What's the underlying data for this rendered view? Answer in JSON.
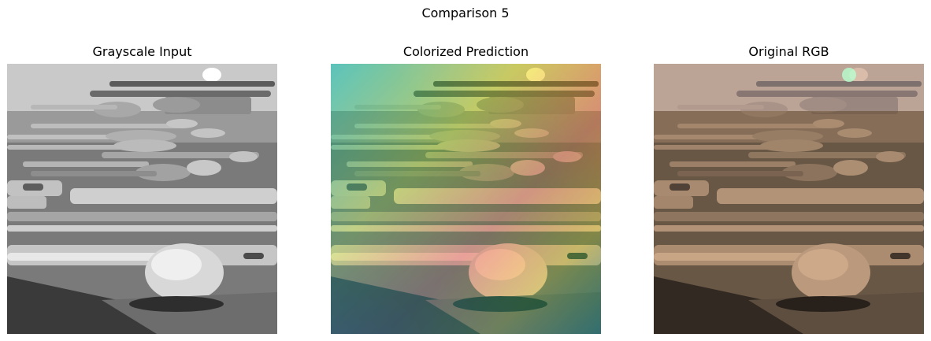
{
  "figure": {
    "title": "Comparison 5"
  },
  "panels": [
    {
      "title": "Grayscale Input"
    },
    {
      "title": "Colorized Prediction"
    },
    {
      "title": "Original RGB"
    }
  ]
}
